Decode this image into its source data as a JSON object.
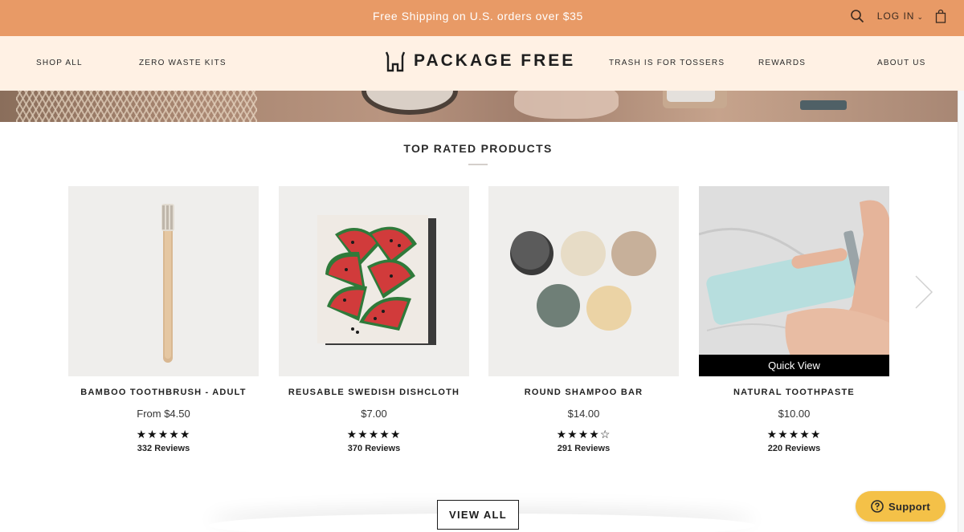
{
  "announcement": {
    "text": "Free Shipping on U.S. orders over $35"
  },
  "utility": {
    "login_label": "LOG IN",
    "search_icon": "search-icon",
    "bag_icon": "shopping-bag-icon"
  },
  "nav": {
    "left": [
      "SHOP ALL",
      "ZERO WASTE KITS"
    ],
    "logo": "PACKAGE FREE",
    "right": [
      "TRASH IS FOR TOSSERS",
      "REWARDS",
      "ABOUT US"
    ]
  },
  "section": {
    "title": "TOP RATED PRODUCTS"
  },
  "products": [
    {
      "name": "BAMBOO TOOTHBRUSH - ADULT",
      "price": "From $4.50",
      "stars": "★★★★★",
      "rating": 5,
      "reviews": "332 Reviews"
    },
    {
      "name": "REUSABLE SWEDISH DISHCLOTH",
      "price": "$7.00",
      "stars": "★★★★★",
      "rating": 5,
      "reviews": "370 Reviews"
    },
    {
      "name": "ROUND SHAMPOO BAR",
      "price": "$14.00",
      "stars": "★★★★☆",
      "rating": 4.5,
      "reviews": "291 Reviews"
    },
    {
      "name": "NATURAL TOOTHPASTE",
      "price": "$10.00",
      "stars": "★★★★★",
      "rating": 5,
      "reviews": "220 Reviews",
      "overlay": "Quick View"
    }
  ],
  "view_all_label": "VIEW ALL",
  "support_label": "Support",
  "colors": {
    "announcement_bg": "#e89a66",
    "nav_bg": "#fff1e4",
    "support_bg": "#f4c148"
  }
}
